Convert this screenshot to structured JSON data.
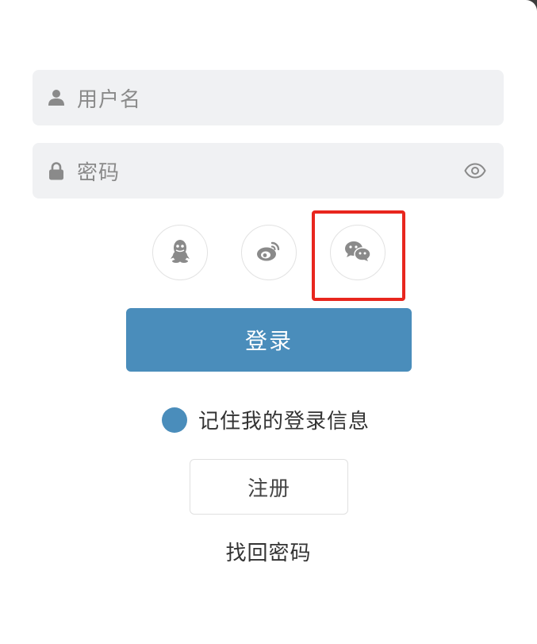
{
  "form": {
    "username_placeholder": "用户名",
    "password_placeholder": "密码",
    "login_label": "登录",
    "remember_label": "记住我的登录信息",
    "register_label": "注册",
    "forgot_label": "找回密码"
  },
  "social": [
    "qq-icon",
    "weibo-icon",
    "wechat-icon"
  ],
  "colors": {
    "primary": "#4a8dbb",
    "field_bg": "#f0f1f3",
    "icon_gray": "#8a8a8a",
    "highlight": "#e8261e"
  }
}
